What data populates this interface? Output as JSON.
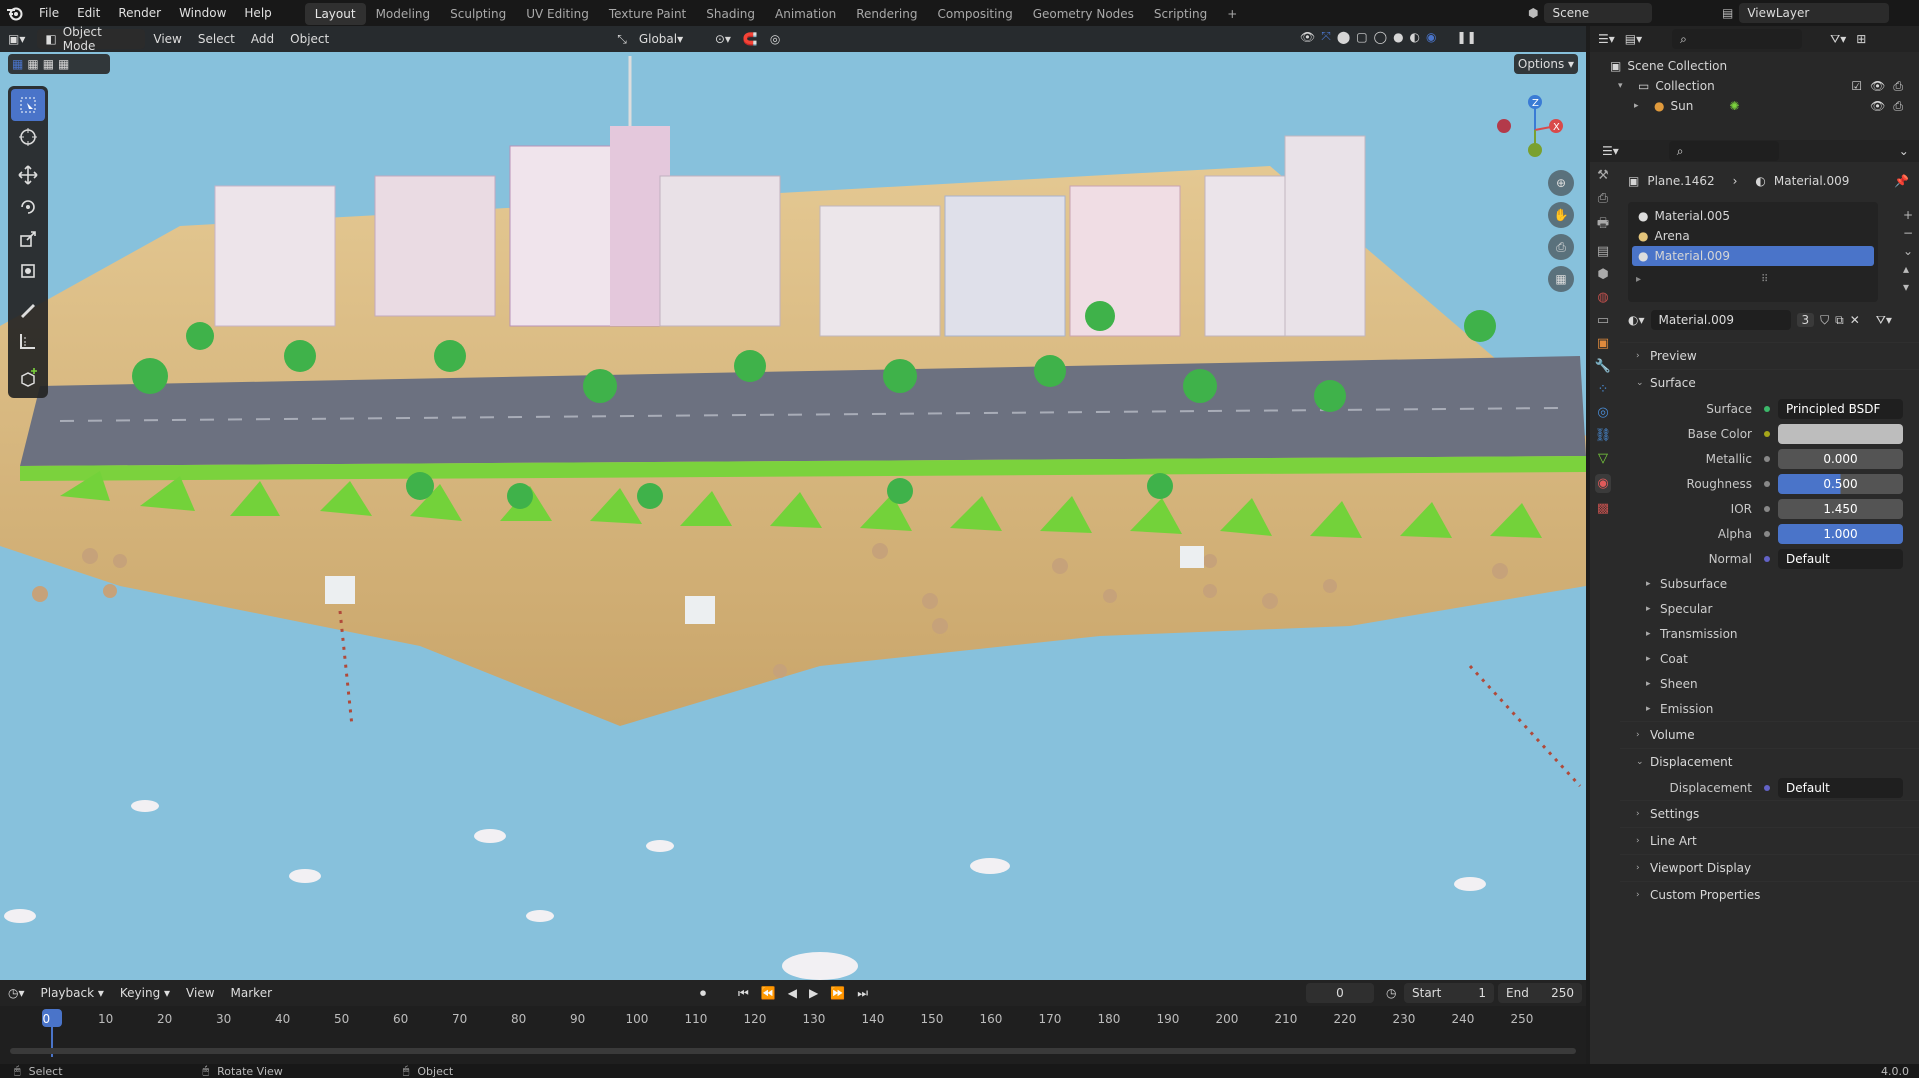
{
  "app": {
    "logo": "blender-logo",
    "version": "4.0.0"
  },
  "menu": [
    "File",
    "Edit",
    "Render",
    "Window",
    "Help"
  ],
  "workspaces": [
    "Layout",
    "Modeling",
    "Sculpting",
    "UV Editing",
    "Texture Paint",
    "Shading",
    "Animation",
    "Rendering",
    "Compositing",
    "Geometry Nodes",
    "Scripting"
  ],
  "active_workspace": "Layout",
  "scene": {
    "name": "Scene",
    "view_layer": "ViewLayer"
  },
  "viewport_header": {
    "mode": "Object Mode",
    "menus": [
      "View",
      "Select",
      "Add",
      "Object"
    ],
    "transform_orientation": "Global",
    "options": "Options"
  },
  "toolbar_icons": [
    "select-box-icon",
    "cursor-icon",
    "move-icon",
    "rotate-icon",
    "scale-icon",
    "transform-icon",
    "annotate-icon",
    "measure-icon",
    "add-cube-icon"
  ],
  "outliner": {
    "root": "Scene Collection",
    "items": [
      {
        "label": "Collection"
      },
      {
        "label": "Sun"
      }
    ]
  },
  "properties": {
    "breadcrumb": {
      "object": "Plane.1462",
      "material": "Material.009"
    },
    "material_slots": [
      "Material.005",
      "Arena",
      "Material.009"
    ],
    "selected_slot": "Material.009",
    "material_name": "Material.009",
    "user_count": "3",
    "sections": {
      "preview": "Preview",
      "surface": "Surface",
      "volume": "Volume",
      "displacement": "Displacement",
      "settings": "Settings",
      "line_art": "Line Art",
      "viewport_display": "Viewport Display",
      "custom_properties": "Custom Properties"
    },
    "surface_fields": {
      "surface_label": "Surface",
      "surface_value": "Principled BSDF",
      "base_color_label": "Base Color",
      "base_color": "#bdbdbd",
      "metallic_label": "Metallic",
      "metallic": "0.000",
      "roughness_label": "Roughness",
      "roughness": "0.500",
      "ior_label": "IOR",
      "ior": "1.450",
      "alpha_label": "Alpha",
      "alpha": "1.000",
      "normal_label": "Normal",
      "normal": "Default"
    },
    "subpanels": [
      "Subsurface",
      "Specular",
      "Transmission",
      "Coat",
      "Sheen",
      "Emission"
    ],
    "displacement_label": "Displacement",
    "displacement_value": "Default"
  },
  "timeline": {
    "menus": [
      "Playback",
      "Keying",
      "View",
      "Marker"
    ],
    "current_frame": "0",
    "start_label": "Start",
    "start": "1",
    "end_label": "End",
    "end": "250",
    "ticks": [
      "0",
      "10",
      "20",
      "30",
      "40",
      "50",
      "60",
      "70",
      "80",
      "90",
      "100",
      "110",
      "120",
      "130",
      "140",
      "150",
      "160",
      "170",
      "180",
      "190",
      "200",
      "210",
      "220",
      "230",
      "240",
      "250"
    ]
  },
  "statusbar": {
    "select": "Select",
    "rotate": "Rotate View",
    "object": "Object"
  },
  "colors": {
    "accent": "#4a74c9",
    "water": "#87c1dc",
    "sand": "#dcc08c",
    "grass": "#7bd23d",
    "road": "#6c7180"
  }
}
